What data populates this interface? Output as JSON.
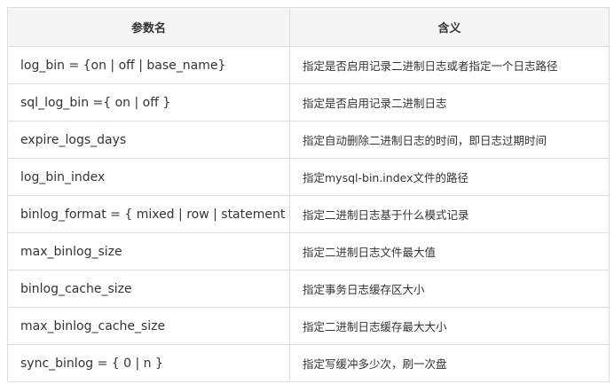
{
  "table": {
    "headers": [
      "参数名",
      "含义"
    ],
    "rows": [
      {
        "param": "log_bin = {on | off | base_name}",
        "desc": "指定是否启用记录二进制日志或者指定一个日志路径"
      },
      {
        "param": "sql_log_bin ={ on | off }",
        "desc": "指定是否启用记录二进制日志"
      },
      {
        "param": "expire_logs_days",
        "desc": "指定自动删除二进制日志的时间，即日志过期时间"
      },
      {
        "param": "log_bin_index",
        "desc": "指定mysql-bin.index文件的路径"
      },
      {
        "param": "binlog_format = { mixed | row | statement }",
        "desc": "指定二进制日志基于什么模式记录"
      },
      {
        "param": "max_binlog_size",
        "desc": "指定二进制日志文件最大值"
      },
      {
        "param": "binlog_cache_size",
        "desc": "指定事务日志缓存区大小"
      },
      {
        "param": "max_binlog_cache_size",
        "desc": "指定二进制日志缓存最大大小"
      },
      {
        "param": "sync_binlog = { 0 | n }",
        "desc": "指定写缓冲多少次，刷一次盘"
      }
    ]
  }
}
